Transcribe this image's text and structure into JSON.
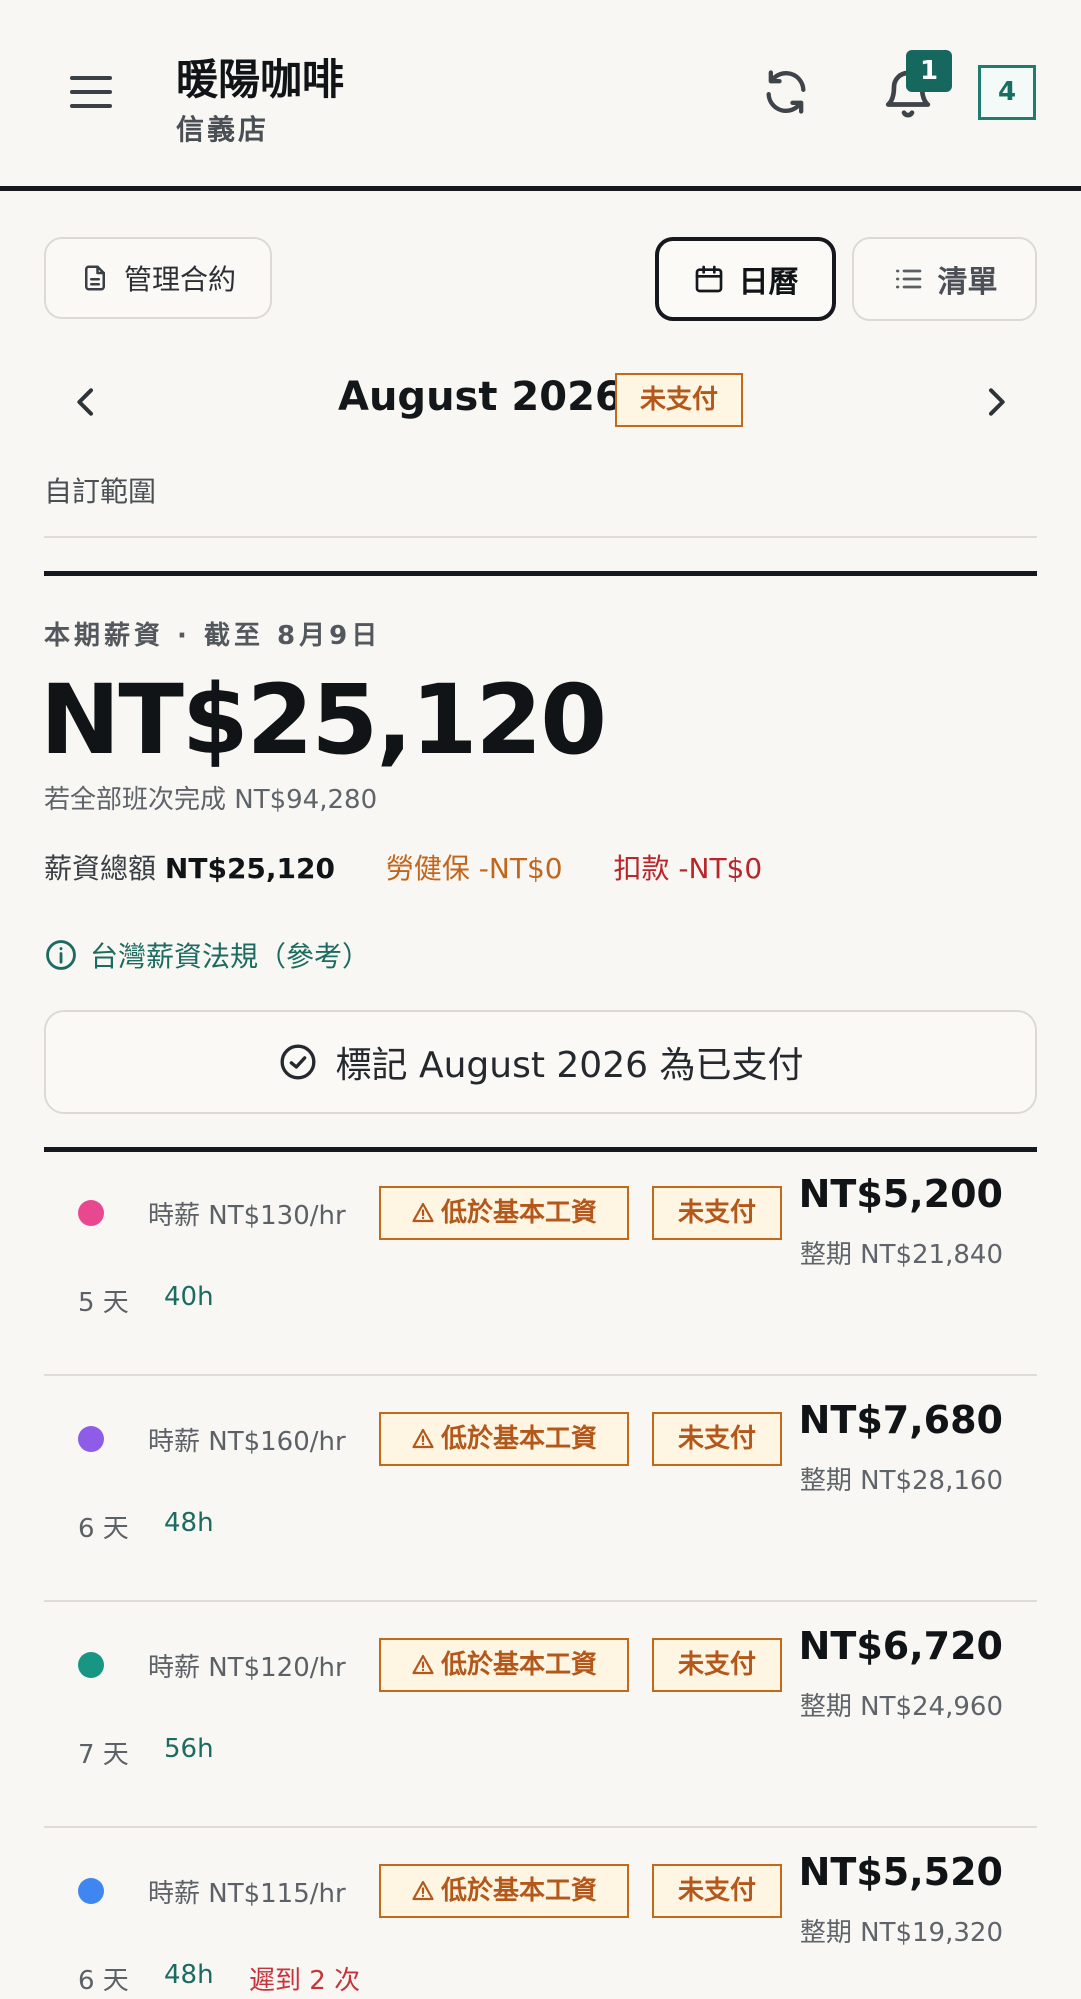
{
  "header": {
    "shop_name": "暖陽咖啡",
    "branch": "信義店",
    "notification_count": "1",
    "box_count": "4"
  },
  "toolbar": {
    "manage_label": "管理合約",
    "calendar_label": "日曆",
    "list_label": "清單"
  },
  "month_nav": {
    "title": "August 2026",
    "status": "未支付",
    "custom_range": "自訂範圍"
  },
  "summary": {
    "period_label": "本期薪資 · 截至 8月9日",
    "amount": "NT$25,120",
    "projected": "若全部班次完成 NT$94,280",
    "gross_label": "薪資總額",
    "gross_value": "NT$25,120",
    "insurance": "勞健保 -NT$0",
    "deduction": "扣款 -NT$0",
    "law_link": "台灣薪資法規（參考）",
    "mark_paid": "標記 August 2026 為已支付"
  },
  "employees": [
    {
      "color": "#e8488f",
      "rate": "時薪 NT$130/hr",
      "warning": "低於基本工資",
      "status": "未支付",
      "amount": "NT$5,200",
      "full_period": "整期 NT$21,840",
      "days": "5 天",
      "hours": "40h",
      "late": ""
    },
    {
      "color": "#8e5ce8",
      "rate": "時薪 NT$160/hr",
      "warning": "低於基本工資",
      "status": "未支付",
      "amount": "NT$7,680",
      "full_period": "整期 NT$28,160",
      "days": "6 天",
      "hours": "48h",
      "late": ""
    },
    {
      "color": "#169683",
      "rate": "時薪 NT$120/hr",
      "warning": "低於基本工資",
      "status": "未支付",
      "amount": "NT$6,720",
      "full_period": "整期 NT$24,960",
      "days": "7 天",
      "hours": "56h",
      "late": ""
    },
    {
      "color": "#3f86f0",
      "rate": "時薪 NT$115/hr",
      "warning": "低於基本工資",
      "status": "未支付",
      "amount": "NT$5,520",
      "full_period": "整期 NT$19,320",
      "days": "6 天",
      "hours": "48h",
      "late": "遲到 2 次"
    }
  ]
}
